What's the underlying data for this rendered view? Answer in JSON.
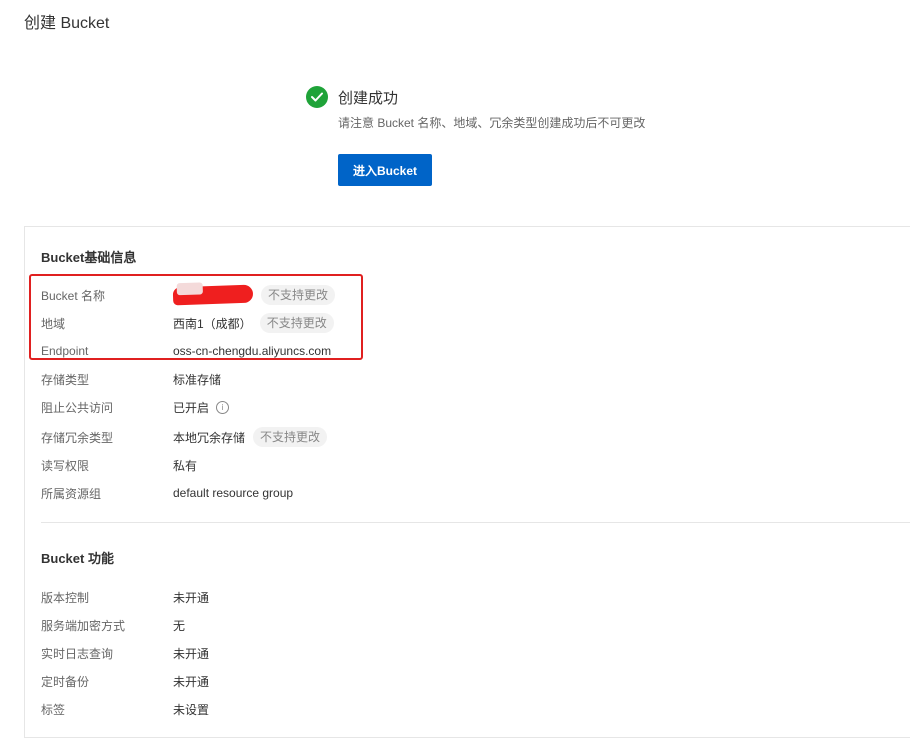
{
  "page_title": "创建 Bucket",
  "success": {
    "title": "创建成功",
    "note": "请注意 Bucket 名称、地域、冗余类型创建成功后不可更改",
    "button_label": "进入Bucket"
  },
  "basic_info": {
    "title": "Bucket基础信息",
    "rows": [
      {
        "label": "Bucket 名称",
        "value": "",
        "tag": "不支持更改"
      },
      {
        "label": "地域",
        "value": "西南1（成都）",
        "tag": "不支持更改"
      },
      {
        "label": "Endpoint",
        "value": "oss-cn-chengdu.aliyuncs.com"
      },
      {
        "label": "存储类型",
        "value": "标准存储"
      },
      {
        "label": "阻止公共访问",
        "value": "已开启",
        "info_icon": "i"
      },
      {
        "label": "存储冗余类型",
        "value": "本地冗余存储",
        "tag": "不支持更改"
      },
      {
        "label": "读写权限",
        "value": "私有"
      },
      {
        "label": "所属资源组",
        "value": "default resource group"
      }
    ]
  },
  "features": {
    "title": "Bucket 功能",
    "rows": [
      {
        "label": "版本控制",
        "value": "未开通"
      },
      {
        "label": "服务端加密方式",
        "value": "无"
      },
      {
        "label": "实时日志查询",
        "value": "未开通"
      },
      {
        "label": "定时备份",
        "value": "未开通"
      },
      {
        "label": "标签",
        "value": "未设置"
      }
    ]
  },
  "colors": {
    "primary": "#0064c8",
    "success": "#1fa339",
    "highlight": "#e02020"
  }
}
